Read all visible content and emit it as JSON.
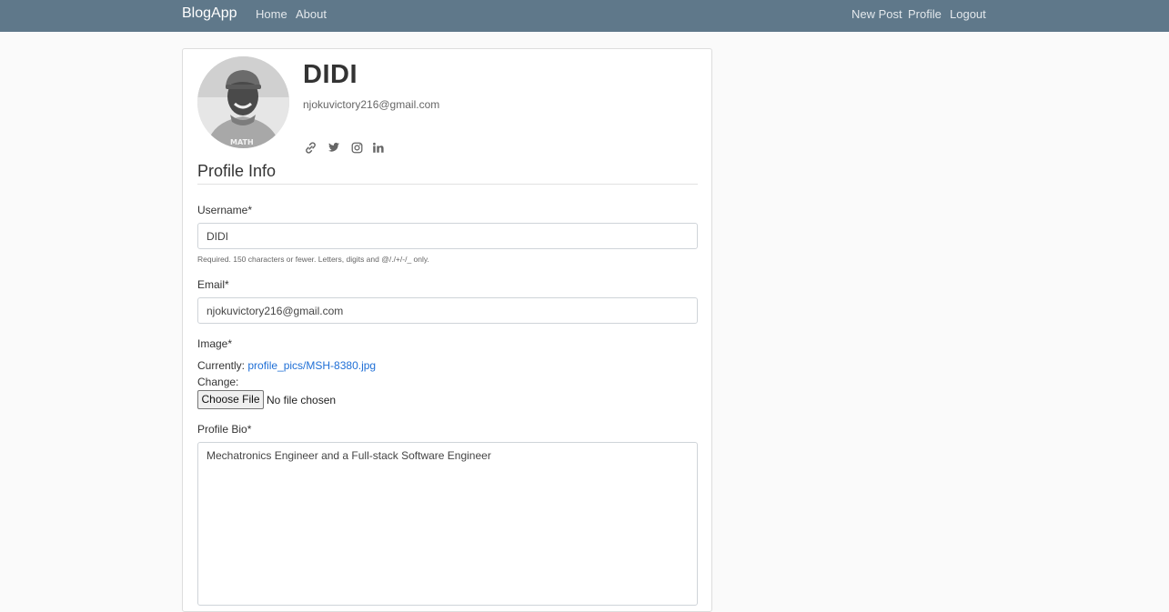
{
  "navbar": {
    "brand": "BlogApp",
    "left_links": [
      "Home",
      "About"
    ],
    "right_links": [
      "New Post",
      "Profile",
      "Logout"
    ]
  },
  "profile": {
    "username": "DIDI",
    "email": "njokuvictory216@gmail.com",
    "social_icons": [
      "link-icon",
      "twitter-icon",
      "instagram-icon",
      "linkedin-icon"
    ]
  },
  "form": {
    "section_title": "Profile Info",
    "username_label": "Username*",
    "username_value": "DIDI",
    "username_help": "Required. 150 characters or fewer. Letters, digits and @/./+/-/_ only.",
    "email_label": "Email*",
    "email_value": "njokuvictory216@gmail.com",
    "image_label": "Image*",
    "currently_label": "Currently:",
    "current_image": "profile_pics/MSH-8380.jpg",
    "change_label": "Change:",
    "choose_file_label": "Choose File",
    "no_file_text": "No file chosen",
    "bio_label": "Profile Bio*",
    "bio_value": "Mechatronics Engineer and a Full-stack Software Engineer"
  },
  "colors": {
    "navbar": "#5f788a",
    "link": "#1f6fd6",
    "background": "#fafafa"
  }
}
